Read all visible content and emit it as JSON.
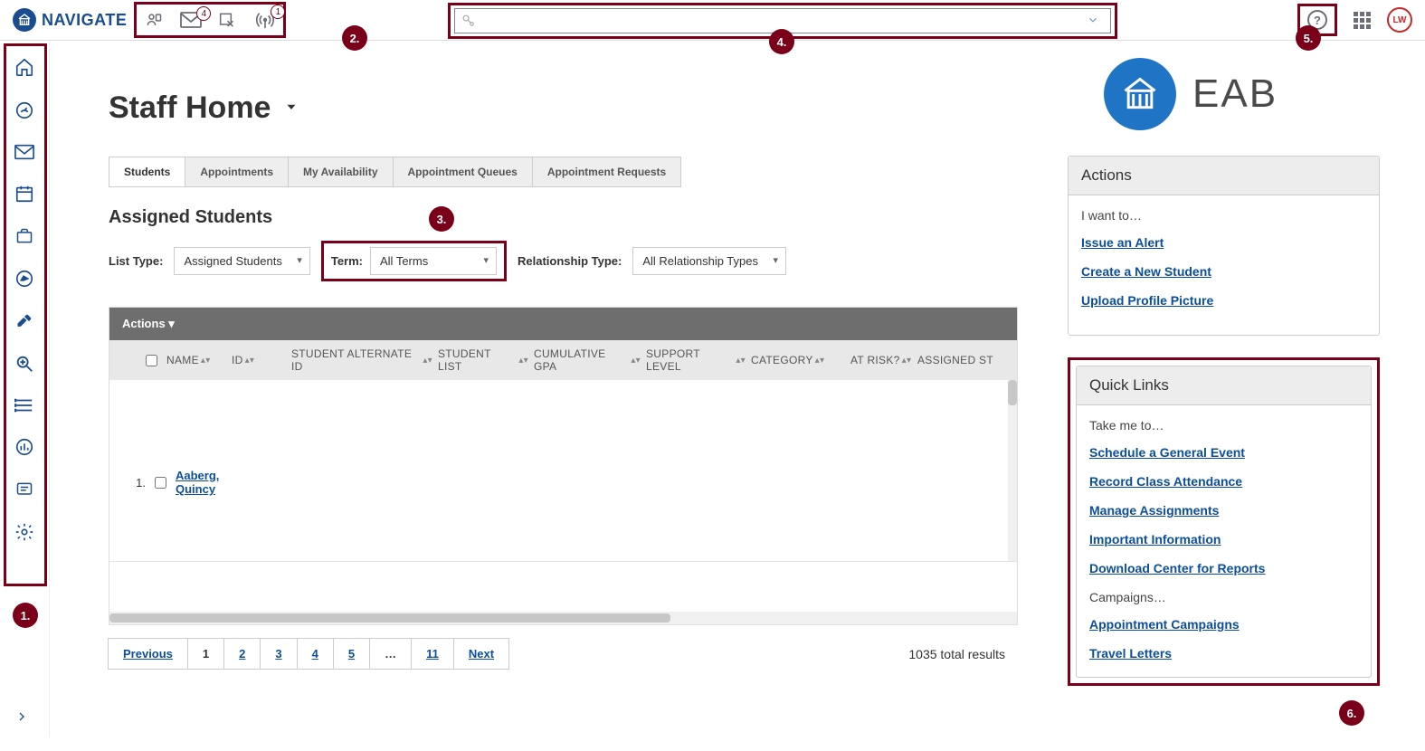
{
  "brand": {
    "nav_label": "NAVIGATE",
    "right_brand": "EAB"
  },
  "top_icons": {
    "badges": {
      "mail": "4",
      "antenna": "1"
    }
  },
  "callouts": {
    "c1": "1.",
    "c2": "2.",
    "c3": "3.",
    "c4": "4.",
    "c5": "5.",
    "c6": "6."
  },
  "avatar": "LW",
  "page": {
    "title": "Staff Home"
  },
  "tabs": [
    "Students",
    "Appointments",
    "My Availability",
    "Appointment Queues",
    "Appointment Requests"
  ],
  "section_title": "Assigned Students",
  "filters": {
    "list_type_label": "List Type:",
    "list_type_value": "Assigned Students",
    "term_label": "Term:",
    "term_value": "All Terms",
    "rel_label": "Relationship Type:",
    "rel_value": "All Relationship Types"
  },
  "table": {
    "actions_label": "Actions ▾",
    "columns": [
      "NAME",
      "ID",
      "STUDENT ALTERNATE ID",
      "STUDENT LIST",
      "CUMULATIVE GPA",
      "SUPPORT LEVEL",
      "CATEGORY",
      "AT RISK?",
      "ASSIGNED ST"
    ],
    "rows": [
      {
        "n": "1.",
        "name": "Aaberg, Quincy"
      }
    ]
  },
  "pager": {
    "prev": "Previous",
    "pages": [
      "1",
      "2",
      "3",
      "4",
      "5",
      "…",
      "11"
    ],
    "next": "Next",
    "results": "1035 total results"
  },
  "actions_panel": {
    "title": "Actions",
    "lead": "I want to…",
    "links": [
      "Issue an Alert",
      "Create a New Student",
      "Upload Profile Picture"
    ]
  },
  "quick_links_panel": {
    "title": "Quick Links",
    "lead": "Take me to…",
    "links": [
      "Schedule a General Event",
      "Record Class Attendance",
      "Manage Assignments",
      "Important Information",
      "Download Center for Reports"
    ],
    "campaigns_lead": "Campaigns…",
    "campaigns_links": [
      "Appointment Campaigns",
      "Travel Letters"
    ]
  }
}
